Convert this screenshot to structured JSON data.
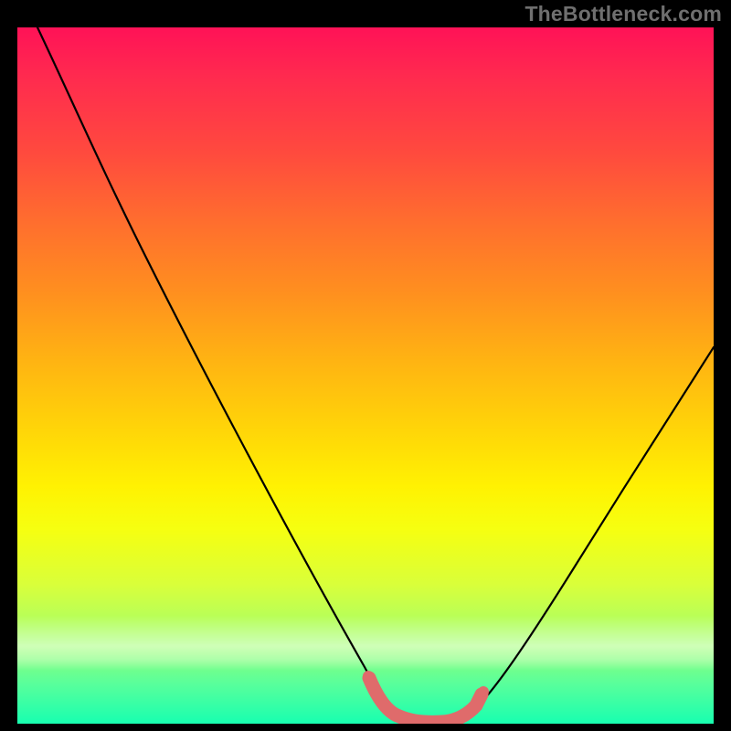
{
  "watermark": "TheBottleneck.com",
  "chart_data": {
    "type": "line",
    "title": "",
    "xlabel": "",
    "ylabel": "",
    "xlim": [
      0,
      100
    ],
    "ylim": [
      0,
      100
    ],
    "grid": false,
    "series": [
      {
        "name": "bottleneck-curve",
        "x": [
          3,
          10,
          20,
          30,
          40,
          50,
          52,
          55,
          58,
          61,
          64,
          66,
          75,
          85,
          95,
          100
        ],
        "y": [
          100,
          87,
          69,
          51,
          33,
          13,
          7,
          2,
          0,
          0,
          1,
          4,
          18,
          34,
          50,
          57
        ],
        "color": "#000000"
      },
      {
        "name": "optimal-marker",
        "x": [
          52,
          55,
          58,
          61,
          64
        ],
        "y": [
          5,
          1.5,
          0.5,
          0.8,
          4
        ],
        "color": "#e06a6a"
      }
    ],
    "background_gradient": {
      "stops": [
        {
          "pos": 0,
          "color": "#ff1257"
        },
        {
          "pos": 50,
          "color": "#ffd000"
        },
        {
          "pos": 72,
          "color": "#f6ff10"
        },
        {
          "pos": 100,
          "color": "#18ffb0"
        }
      ]
    }
  }
}
